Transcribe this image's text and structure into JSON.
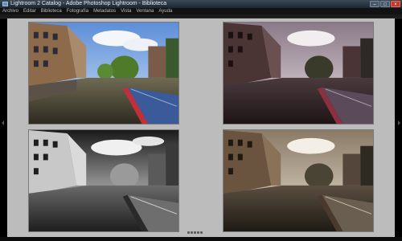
{
  "window": {
    "title": "Lightroom 2 Catalog - Adobe Photoshop Lightroom - Biblioteca",
    "controls": [
      "–",
      "□",
      "×"
    ]
  },
  "menu": [
    "Archivo",
    "Editar",
    "Biblioteca",
    "Fotografía",
    "Metadatos",
    "Vista",
    "Ventana",
    "Ayuda"
  ],
  "photos": [
    {
      "name": "photo-canal-color",
      "treatment": "color"
    },
    {
      "name": "photo-canal-warm-tone",
      "treatment": "warm-tone"
    },
    {
      "name": "photo-canal-black-white",
      "treatment": "black-white"
    },
    {
      "name": "photo-canal-split-tone",
      "treatment": "split-tone"
    }
  ],
  "colors": {
    "background": "#bcbcbc",
    "titlebar": "#2a3644",
    "menubar": "#121212"
  }
}
